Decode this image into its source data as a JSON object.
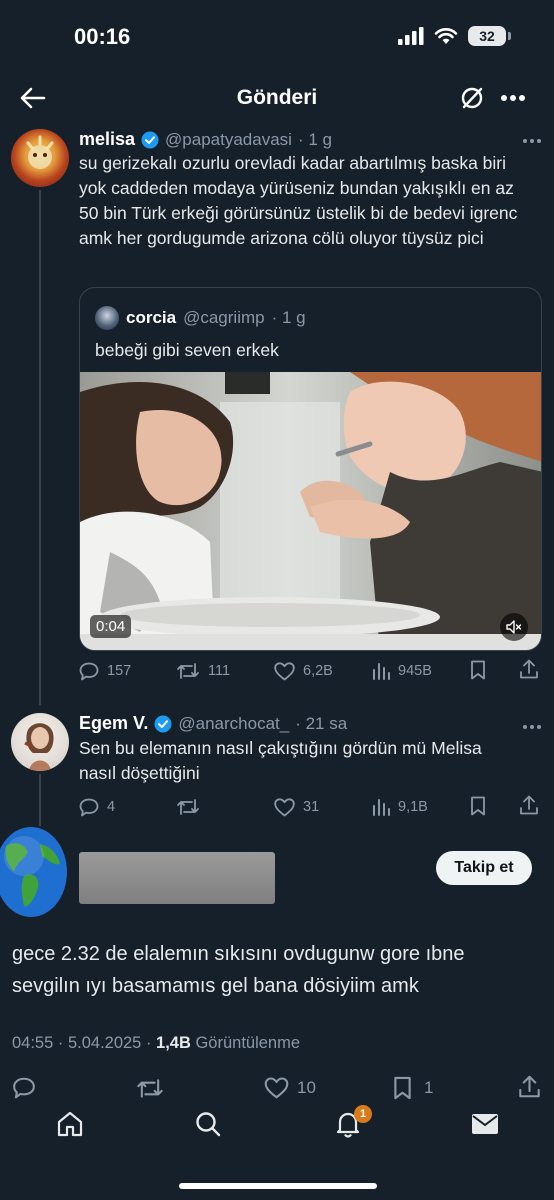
{
  "status_bar": {
    "time": "00:16",
    "battery": "32"
  },
  "header": {
    "title": "Gönderi"
  },
  "tweet1": {
    "name": "melisa",
    "handle": "@papatyadavasi",
    "time": "· 1 g",
    "text": "su gerizekalı ozurlu orevladi kadar abartılmış baska biri yok caddeden modaya yürüseniz bundan yakışıklı en az 50 bin Türk erkeği görürsünüz üstelik bi de bedevi igrenc amk her gordugumde arizona cölü oluyor tüysüz pici",
    "quote": {
      "name": "corcia",
      "handle": "@cagriimp",
      "time": "· 1 g",
      "text": "bebeği gibi seven erkek",
      "video_duration": "0:04"
    },
    "stats": {
      "replies": "157",
      "retweets": "111",
      "likes": "6,2B",
      "views": "945B"
    }
  },
  "tweet2": {
    "name": "Egem V.",
    "handle": "@anarchocat_",
    "time": "· 21 sa",
    "text": "Sen bu elemanın nasıl çakıştığını gördün mü Melisa nasıl döşettiğini",
    "stats": {
      "replies": "4",
      "retweets": "",
      "likes": "31",
      "views": "9,1B"
    }
  },
  "main_post": {
    "follow_label": "Takip et",
    "text": "gece 2.32 de elalemın sıkısını ovdugunw gore ıbne sevgilın ıyı basamamıs gel bana dösiyiim amk",
    "timestamp": "04:55 · 5.04.2025 · ",
    "views_count": "1,4B",
    "views_label": " Görüntülenme",
    "stats": {
      "replies": "",
      "retweets": "",
      "likes": "10",
      "bookmarks": "1"
    }
  },
  "tab_bar": {
    "notifications_badge": "1"
  },
  "colors": {
    "background": "#15202b",
    "verified": "#1d9bf0",
    "muted": "#8b98a5",
    "badge": "#d97b1a"
  }
}
